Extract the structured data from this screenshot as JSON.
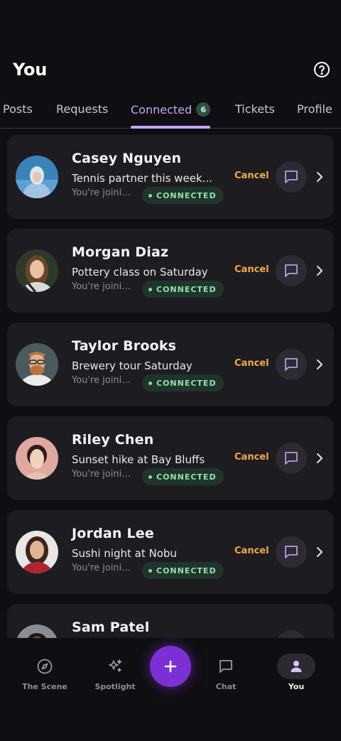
{
  "header": {
    "title": "You",
    "help_icon": "help-circle-icon"
  },
  "tabs": [
    {
      "label": "Posts",
      "active": false
    },
    {
      "label": "Requests",
      "active": false
    },
    {
      "label": "Connected",
      "active": true,
      "badge": "6"
    },
    {
      "label": "Tickets",
      "active": false
    },
    {
      "label": "Profile",
      "active": false
    }
  ],
  "connections": [
    {
      "name": "Casey Nguyen",
      "subtitle": "Tennis partner this week...",
      "meta": "You're joinin...",
      "status": "CONNECTED",
      "cancel": "Cancel",
      "avatar": "avatar-photo"
    },
    {
      "name": "Morgan Diaz",
      "subtitle": "Pottery class on Saturday",
      "meta": "You're joinin...",
      "status": "CONNECTED",
      "cancel": "Cancel",
      "avatar": "avatar-photo"
    },
    {
      "name": "Taylor Brooks",
      "subtitle": "Brewery tour Saturday",
      "meta": "You're joinin...",
      "status": "CONNECTED",
      "cancel": "Cancel",
      "avatar": "avatar-photo"
    },
    {
      "name": "Riley Chen",
      "subtitle": "Sunset hike at Bay Bluffs",
      "meta": "You're joinin...",
      "status": "CONNECTED",
      "cancel": "Cancel",
      "avatar": "avatar-photo"
    },
    {
      "name": "Jordan Lee",
      "subtitle": "Sushi night at Nobu",
      "meta": "You're joinin...",
      "status": "CONNECTED",
      "cancel": "Cancel",
      "avatar": "avatar-photo"
    },
    {
      "name": "Sam Patel",
      "subtitle": "",
      "meta": "",
      "status": "",
      "cancel": "",
      "avatar": "avatar-photo"
    }
  ],
  "bottom_nav": {
    "items": [
      {
        "label": "The Scene",
        "icon": "compass-icon",
        "active": false
      },
      {
        "label": "Spotlight",
        "icon": "sparkles-icon",
        "active": false
      },
      {
        "label": "Chat",
        "icon": "chat-icon",
        "active": false
      },
      {
        "label": "You",
        "icon": "person-icon",
        "active": true
      }
    ],
    "fab_icon": "plus-icon"
  },
  "colors": {
    "background": "#0f0e12",
    "card": "#1d1c21",
    "accent": "#c7a6f2",
    "cancel": "#f0a94a",
    "connected": "#8fe2b0",
    "fab": "#7b2fd4"
  }
}
